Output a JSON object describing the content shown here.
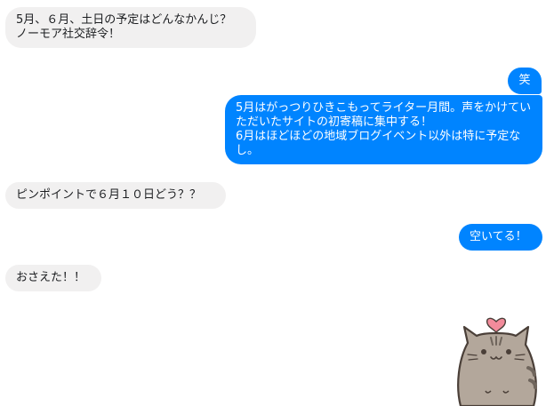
{
  "messages": [
    {
      "id": "m1",
      "side": "incoming",
      "text": "5月、６月、土日の予定はどんなかんじ？\nノーモア社交辞令！"
    },
    {
      "id": "m2",
      "side": "outgoing",
      "text": "笑"
    },
    {
      "id": "m3",
      "side": "outgoing",
      "text": "5月はがっつりひきこもってライター月間。声をかけていただいたサイトの初寄稿に集中する！\n6月はほどほどの地域ブログイベント以外は特に予定なし。"
    },
    {
      "id": "m4",
      "side": "incoming",
      "text": "ピンポイントで６月１０日どう？？"
    },
    {
      "id": "m5",
      "side": "outgoing",
      "text": "空いてる！"
    },
    {
      "id": "m6",
      "side": "incoming",
      "text": "おさえた！！"
    }
  ],
  "sticker": {
    "icon": "pusheen-cat-heart-sticker",
    "colors": {
      "body": "#b3a79b",
      "stripe": "#6f655c",
      "outline": "#4a3f38",
      "heart": "#f28b9b"
    }
  },
  "colors": {
    "outgoing_bubble": "#0084ff",
    "incoming_bubble": "#f1f0f0"
  }
}
